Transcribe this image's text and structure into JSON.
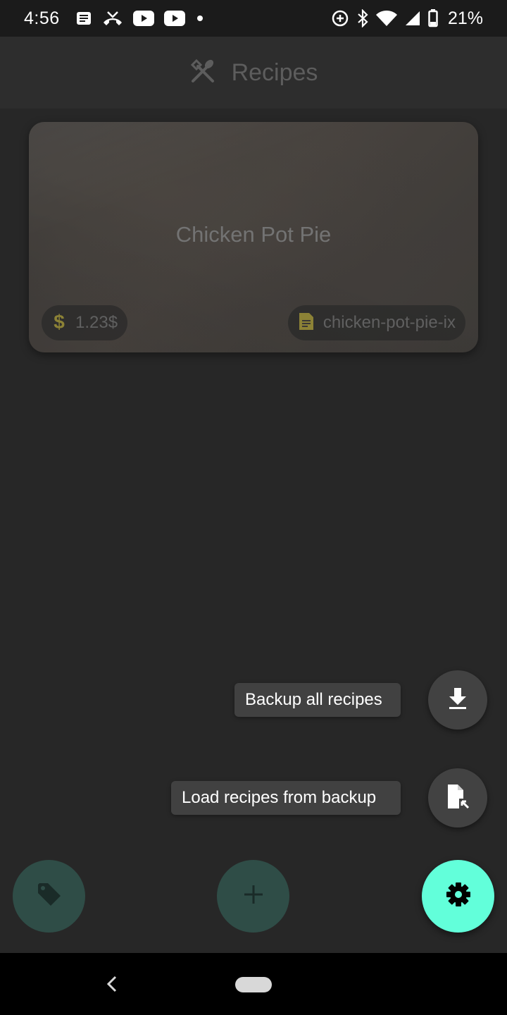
{
  "status_bar": {
    "time": "4:56",
    "battery_text": "21%",
    "left_icons": [
      "message-icon",
      "missed-call-icon",
      "youtube-icon",
      "youtube-icon",
      "dot-icon"
    ],
    "right_icons": [
      "data-saver-icon",
      "bluetooth-icon",
      "wifi-icon",
      "signal-icon",
      "battery-icon"
    ]
  },
  "app_bar": {
    "icon": "utensils-icon",
    "title": "Recipes"
  },
  "recipes": [
    {
      "title": "Chicken Pot Pie",
      "price": "1.23$",
      "slug": "chicken-pot-pie-ix"
    }
  ],
  "speed_dial": {
    "backup_label": "Backup all recipes",
    "load_label": "Load recipes from backup"
  },
  "colors": {
    "accent": "#62ffda",
    "fab_dimmed": "#2f4d47",
    "chip_icon": "#8c8236",
    "background": "#272727"
  }
}
